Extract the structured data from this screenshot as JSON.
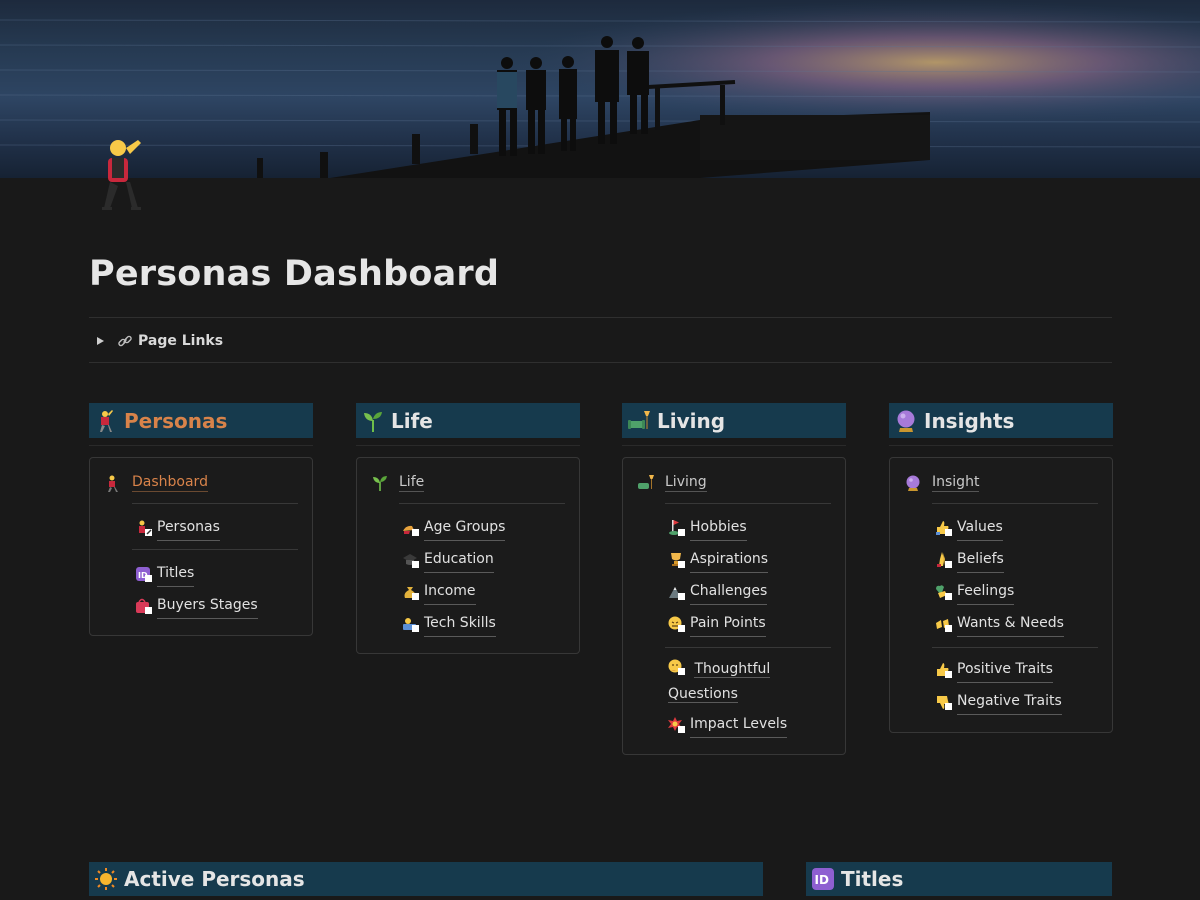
{
  "page": {
    "title": "Personas Dashboard"
  },
  "toggle": {
    "label": "Page Links"
  },
  "columns": [
    {
      "heading": "Personas",
      "heading_icon": "person-raising-hand-icon",
      "top_item": {
        "label": "Dashboard",
        "icon": "person-raising-hand-icon"
      },
      "groups": [
        [
          {
            "label": "Personas",
            "icon": "person-link-icon"
          }
        ],
        [
          {
            "label": "Titles",
            "icon": "id-link-icon"
          },
          {
            "label": "Buyers Stages",
            "icon": "shopping-bag-link-icon"
          }
        ]
      ]
    },
    {
      "heading": "Life",
      "heading_icon": "seedling-icon",
      "top_item": {
        "label": "Life",
        "icon": "seedling-icon"
      },
      "groups": [
        [
          {
            "label": "Age Groups",
            "icon": "hand-link-icon"
          },
          {
            "label": "Education",
            "icon": "graduation-cap-link-icon"
          },
          {
            "label": "Income",
            "icon": "money-bag-link-icon"
          },
          {
            "label": "Tech Skills",
            "icon": "technologist-link-icon"
          }
        ]
      ]
    },
    {
      "heading": "Living",
      "heading_icon": "couch-lamp-icon",
      "top_item": {
        "label": "Living",
        "icon": "couch-lamp-icon"
      },
      "groups": [
        [
          {
            "label": "Hobbies",
            "icon": "golf-link-icon"
          },
          {
            "label": "Aspirations",
            "icon": "trophy-link-icon"
          },
          {
            "label": "Challenges",
            "icon": "mountain-link-icon"
          },
          {
            "label": "Pain Points",
            "icon": "face-pain-link-icon"
          }
        ],
        [
          {
            "label": "Thoughtful Questions",
            "icon": "thinking-face-link-icon"
          },
          {
            "label": "Impact Levels",
            "icon": "collision-link-icon"
          }
        ]
      ]
    },
    {
      "heading": "Insights",
      "heading_icon": "crystal-ball-icon",
      "top_item": {
        "label": "Insight",
        "icon": "crystal-ball-icon"
      },
      "groups": [
        [
          {
            "label": "Values",
            "icon": "thumbs-up-link-icon"
          },
          {
            "label": "Beliefs",
            "icon": "pray-link-icon"
          },
          {
            "label": "Feelings",
            "icon": "heart-hands-link-icon"
          },
          {
            "label": "Wants & Needs",
            "icon": "open-hands-link-icon"
          }
        ],
        [
          {
            "label": "Positive Traits",
            "icon": "thumbs-up-link-icon"
          },
          {
            "label": "Negative Traits",
            "icon": "thumbs-down-link-icon"
          }
        ]
      ]
    }
  ],
  "bottom_sections": [
    {
      "heading": "Active Personas",
      "icon": "sun-icon"
    },
    {
      "heading": "Titles",
      "icon": "id-icon"
    }
  ],
  "colors": {
    "heading_bg": "#163a4d",
    "accent_orange": "#d8834a",
    "page_bg": "#191919"
  }
}
